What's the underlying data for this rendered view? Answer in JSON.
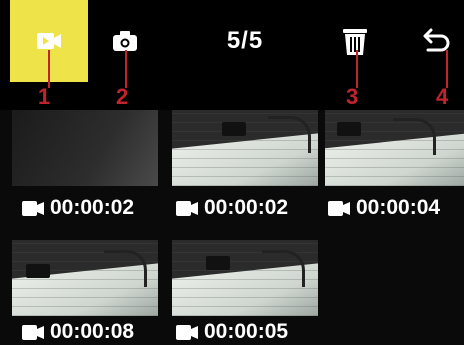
{
  "toolbar": {
    "counter": "5/5",
    "callouts": [
      "1",
      "2",
      "3",
      "4"
    ]
  },
  "icons": {
    "video": "video-camera-icon",
    "photo": "camera-icon",
    "delete": "trash-icon",
    "back": "back-arrow-icon"
  },
  "colors": {
    "accent": "#efe34a",
    "callout": "#c0242d",
    "background": "#000000"
  },
  "thumbnails": [
    {
      "duration": "00:00:02"
    },
    {
      "duration": "00:00:02"
    },
    {
      "duration": "00:00:04"
    },
    {
      "duration": "00:00:08"
    },
    {
      "duration": "00:00:05"
    }
  ]
}
